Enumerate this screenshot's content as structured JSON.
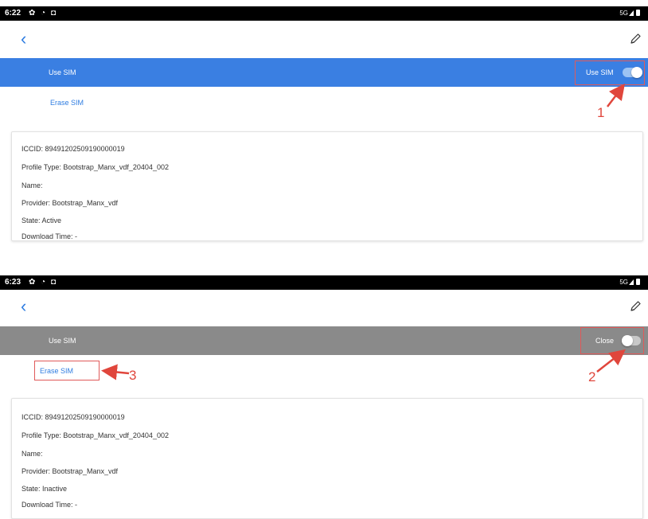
{
  "top": {
    "status": {
      "time": "6:22",
      "status_icons": "✿ ◔ ◘",
      "network": "5G"
    },
    "header": {
      "back_glyph": "‹"
    },
    "row": {
      "label": "Use SIM",
      "toggle_label": "Use SIM",
      "toggle_on": true,
      "color": "#3a7fe2"
    },
    "erase_label": "Erase SIM",
    "info": [
      "ICCID: 89491202509190000019",
      "Profile Type: Bootstrap_Manx_vdf_20404_002",
      "Name:",
      "Provider: Bootstrap_Manx_vdf",
      "State: Active",
      "Download Time: -"
    ]
  },
  "bottom": {
    "status": {
      "time": "6:23",
      "status_icons": "✿ ◔ ◘",
      "network": "5G"
    },
    "header": {
      "back_glyph": "‹"
    },
    "row": {
      "label": "Use SIM",
      "toggle_label": "Close",
      "toggle_on": false,
      "color": "#8a8a8a"
    },
    "erase_label": "Erase SIM",
    "info": [
      "ICCID: 89491202509190000019",
      "Profile Type: Bootstrap_Manx_vdf_20404_002",
      "Name:",
      "Provider: Bootstrap_Manx_vdf",
      "State: Inactive",
      "Download Time: -"
    ]
  },
  "annotations": {
    "step1": "1",
    "step2": "2",
    "step3": "3",
    "color": "#e0463c"
  }
}
